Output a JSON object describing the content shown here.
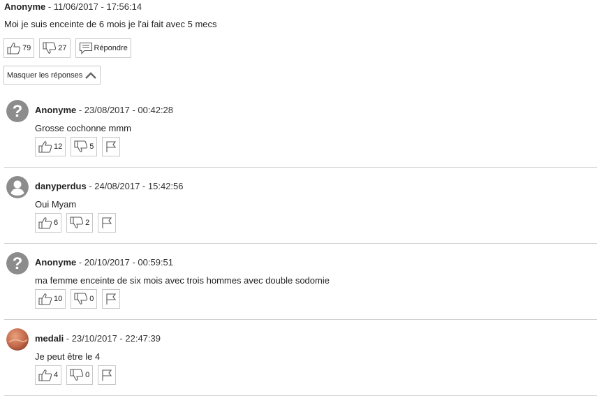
{
  "main_comment": {
    "author": "Anonyme",
    "separator": " - ",
    "date": "11/06/2017 - 17:56:14",
    "text": "Moi je suis enceinte de 6 mois je l'ai fait avec 5 mecs",
    "likes": "79",
    "dislikes": "27",
    "reply_label": "Répondre"
  },
  "toggle_replies_label": "Masquer les réponses",
  "replies": [
    {
      "author": "Anonyme",
      "separator": " - ",
      "date": "23/08/2017 - 00:42:28",
      "text": "Grosse cochonne mmm",
      "likes": "12",
      "dislikes": "5",
      "avatar": "question-avatar-icon"
    },
    {
      "author": "danyperdus",
      "separator": " - ",
      "date": "24/08/2017 - 15:42:56",
      "text": "Oui Myam",
      "likes": "6",
      "dislikes": "2",
      "avatar": "user-avatar-icon"
    },
    {
      "author": "Anonyme",
      "separator": " - ",
      "date": "20/10/2017 - 00:59:51",
      "text": "ma femme enceinte de six mois avec trois hommes avec double sodomie",
      "likes": "10",
      "dislikes": "0",
      "avatar": "question-avatar-icon"
    },
    {
      "author": "medali",
      "separator": " - ",
      "date": "23/10/2017 - 22:47:39",
      "text": "Je peut être le 4",
      "likes": "4",
      "dislikes": "0",
      "avatar": "photo-avatar"
    }
  ],
  "icons": {
    "like": "thumbs-up-icon",
    "dislike": "thumbs-down-icon",
    "reply": "comment-icon",
    "report": "flag-icon",
    "collapse": "chevron-up-icon"
  },
  "colors": {
    "border": "#c8c8c8",
    "divider": "#d0d0d0",
    "avatar_grey": "#8c8c8c"
  }
}
